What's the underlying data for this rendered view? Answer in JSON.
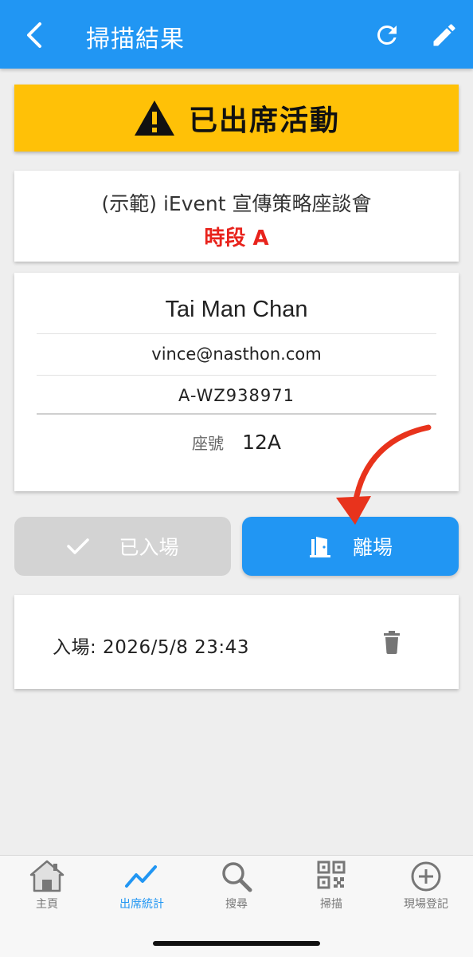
{
  "appbar": {
    "title": "掃描結果"
  },
  "banner": {
    "text": "已出席活動",
    "color": "#ffc107"
  },
  "event": {
    "name": "(示範) iEvent 宣傳策略座談會",
    "session": "時段 A"
  },
  "person": {
    "name": "Tai Man Chan",
    "email": "vince@nasthon.com",
    "code": "A-WZ938971",
    "seat_label": "座號",
    "seat_value": "12A"
  },
  "actions": {
    "entered_label": "已入場",
    "exit_label": "離場"
  },
  "log": {
    "entry": "入場: 2026/5/8 23:43"
  },
  "bottom_nav": {
    "items": [
      {
        "label": "主頁",
        "icon": "home-icon"
      },
      {
        "label": "出席統計",
        "icon": "trending-icon",
        "active": true
      },
      {
        "label": "搜尋",
        "icon": "search-icon"
      },
      {
        "label": "掃描",
        "icon": "qr-code-icon"
      },
      {
        "label": "現場登記",
        "icon": "add-circle-icon"
      }
    ]
  },
  "colors": {
    "primary": "#2196f3",
    "accent_red": "#e8231c",
    "disabled": "#d3d3d3"
  }
}
